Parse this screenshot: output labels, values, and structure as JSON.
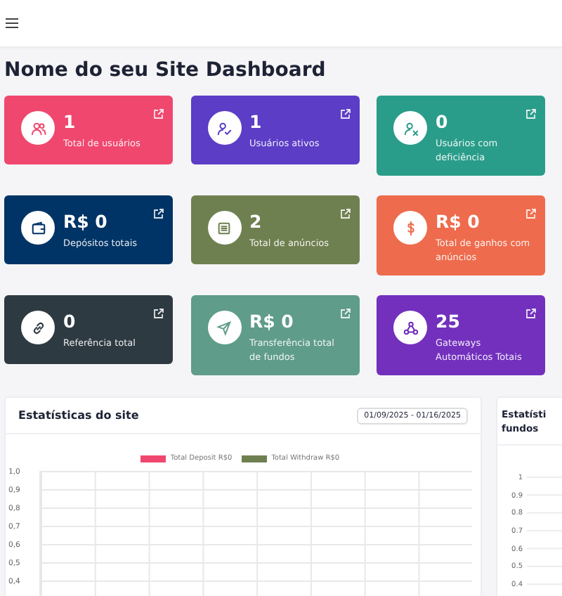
{
  "title": "Nome do seu Site Dashboard",
  "cards": [
    {
      "value": "1",
      "label": "Total de usuários",
      "color": "#f0476e"
    },
    {
      "value": "1",
      "label": "Usuários ativos",
      "color": "#5b3dc6"
    },
    {
      "value": "0",
      "label": "Usuários com deficiência",
      "color": "#2a9d8a"
    },
    {
      "value": "R$ 0",
      "label": "Depósitos totais",
      "color": "#013466"
    },
    {
      "value": "2",
      "label": "Total de anúncios",
      "color": "#6f8050"
    },
    {
      "value": "R$ 0",
      "label": "Total de ganhos com anúncios",
      "color": "#ee6b4d"
    },
    {
      "value": "0",
      "label": "Referência total",
      "color": "#2e3a42"
    },
    {
      "value": "R$ 0",
      "label": "Transferência total de fundos",
      "color": "#5f9c89"
    },
    {
      "value": "25",
      "label": "Gateways Automáticos Totais",
      "color": "#7230bd"
    }
  ],
  "site_stats": {
    "title": "Estatísticas do site",
    "date_range": "01/09/2025 - 01/16/2025",
    "legend": [
      {
        "name": "Total Deposit R$0",
        "color": "#f0476e"
      },
      {
        "name": "Total Withdraw R$0",
        "color": "#6f8050"
      }
    ],
    "y_labels": [
      "1,0",
      "0,9",
      "0,8",
      "0,7",
      "0,6",
      "0,5",
      "0,4"
    ]
  },
  "funds_stats": {
    "title": "Estatísti\nfundos",
    "y_labels": [
      "1",
      "0.9",
      "0.8",
      "0.7",
      "0.6",
      "0.5",
      "0.4"
    ]
  }
}
